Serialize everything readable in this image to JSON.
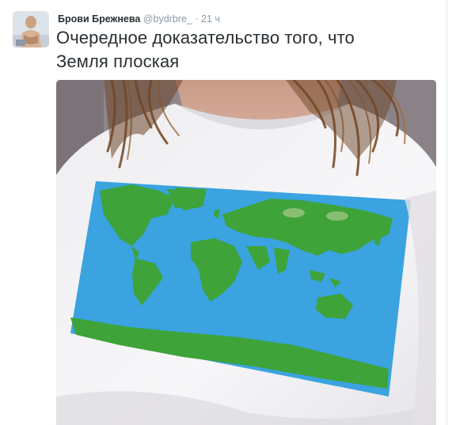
{
  "tweet": {
    "author_name": "Брови Брежнева",
    "author_handle": "@bydrbre_",
    "separator": "·",
    "timestamp": "21 ч",
    "text_line1": "Очередное доказательство того, что",
    "text_line2": "Земля плоская"
  },
  "colors": {
    "name": "#292f33",
    "meta": "#8899a6",
    "ocean": "#3aa3e0",
    "land": "#3ea338",
    "shirt": "#f5f4f6",
    "hair": "#7a4e2a"
  },
  "icons": {
    "avatar": "user-avatar",
    "media": "tweet-photo"
  }
}
